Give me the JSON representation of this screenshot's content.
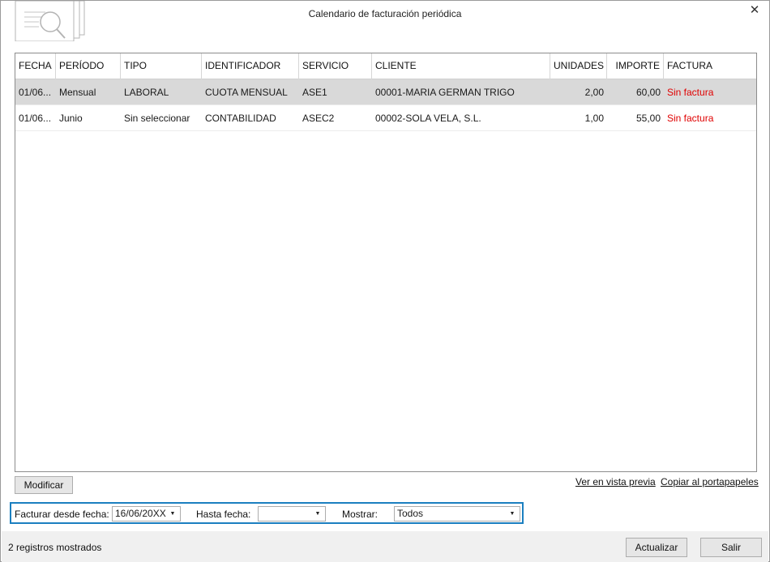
{
  "window": {
    "title": "Calendario de facturación periódica",
    "logo_icon": "search-document-icon",
    "close_icon": "close-icon",
    "close_glyph": "✕"
  },
  "grid": {
    "headers": {
      "fecha": "FECHA",
      "periodo": "PERÍODO",
      "tipo": "TIPO",
      "identificador": "IDENTIFICADOR",
      "servicio": "SERVICIO",
      "cliente": "CLIENTE",
      "unidades": "UNIDADES",
      "importe": "IMPORTE",
      "factura": "FACTURA"
    },
    "rows": [
      {
        "fecha": "01/06...",
        "periodo": "Mensual",
        "tipo": "LABORAL",
        "identificador": "CUOTA MENSUAL",
        "servicio": "ASE1",
        "cliente": "00001-MARIA GERMAN TRIGO",
        "unidades": "2,00",
        "importe": "60,00",
        "factura": "Sin factura"
      },
      {
        "fecha": "01/06...",
        "periodo": "Junio",
        "tipo": "Sin seleccionar",
        "identificador": "CONTABILIDAD",
        "servicio": "ASEC2",
        "cliente": "00002-SOLA VELA, S.L.",
        "unidades": "1,00",
        "importe": "55,00",
        "factura": "Sin factura"
      }
    ],
    "selected_row": 0
  },
  "actions": {
    "modificar_label": "Modificar",
    "preview_link": "Ver en vista previa",
    "copy_link": "Copiar al portapapeles"
  },
  "filters": {
    "desde_label": "Facturar desde fecha:",
    "desde_value": "16/06/20XX",
    "hasta_label": "Hasta fecha:",
    "hasta_value": "",
    "mostrar_label": "Mostrar:",
    "mostrar_value": "Todos",
    "dropdown_icon": "chevron-down-icon",
    "dropdown_glyph": "▼"
  },
  "status": {
    "text": "2 registros mostrados",
    "actualizar_label": "Actualizar",
    "salir_label": "Salir"
  },
  "colors": {
    "accent": "#1b7fc0",
    "selected_row": "#d9d9d9",
    "sin_factura": "#e00000"
  }
}
